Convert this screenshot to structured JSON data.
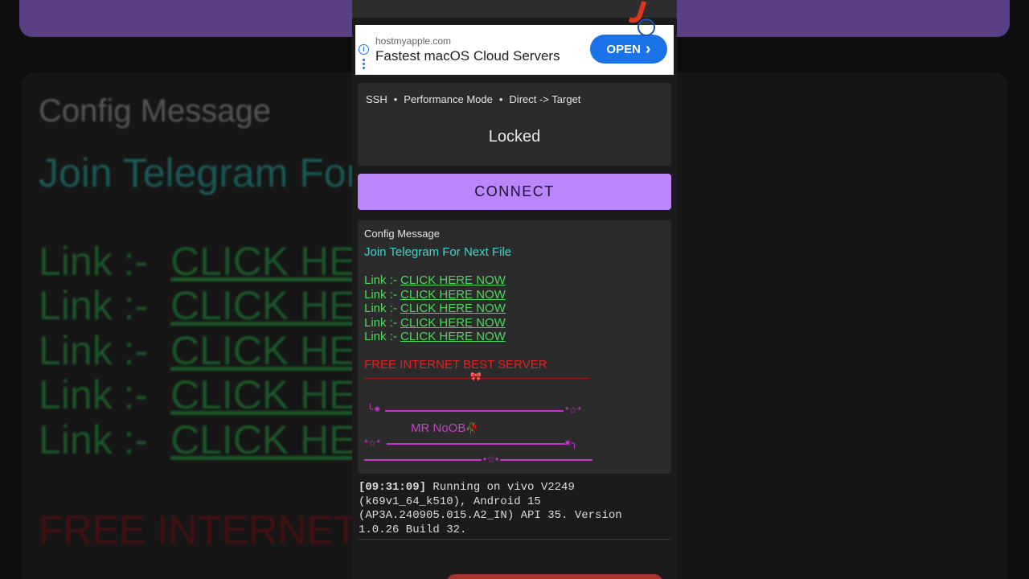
{
  "background": {
    "title": "Config Message",
    "join": "Join Telegram For",
    "link_prefix": "Link :-",
    "link_text": "CLICK HER",
    "free": "FREE INTERNET B"
  },
  "ad": {
    "domain": "hostmyapple.com",
    "title": "Fastest macOS Cloud Servers",
    "open_label": "OPEN",
    "open_chevron": "›"
  },
  "status": {
    "protocol": "SSH",
    "mode": "Performance Mode",
    "route": "Direct -> Target",
    "separator": "•",
    "state": "Locked"
  },
  "connect_label": "CONNECT",
  "config": {
    "title": "Config Message",
    "join": "Join Telegram For Next File",
    "links": [
      {
        "prefix": "Link :- ",
        "text": "CLICK HERE NOW"
      },
      {
        "prefix": "Link :- ",
        "text": "CLICK HERE NOW"
      },
      {
        "prefix": "Link :- ",
        "text": "CLICK HERE NOW"
      },
      {
        "prefix": "Link :- ",
        "text": "CLICK HERE NOW"
      },
      {
        "prefix": "Link :- ",
        "text": "CLICK HERE NOW"
      }
    ],
    "free": "FREE INTERNET BEST SERVER",
    "signature": "MR NoOB",
    "deco_top_left": "╰✷",
    "deco_top_right": "*☆*",
    "deco_bottom_left": "*☆*",
    "deco_bottom_right": "✷╮",
    "deco_star": "•☆•",
    "bow": "🎀",
    "rose": "🥀"
  },
  "log": {
    "time": "[09:31:09]",
    "line1": " Running on vivo V2249",
    "line2": "(k69v1_64_k510), Android 15",
    "line3": "(AP3A.240905.015.A2_IN) API 35. Version",
    "line4": "1.0.26 Build 32."
  },
  "colors": {
    "accent": "#bb86fc",
    "card": "#2b2b2b",
    "link_green": "#4dd95c",
    "telegram_cyan": "#3ed3d0",
    "alert_red": "#e02222",
    "deco_magenta": "#cc33cc",
    "ad_blue": "#1a73e8"
  }
}
